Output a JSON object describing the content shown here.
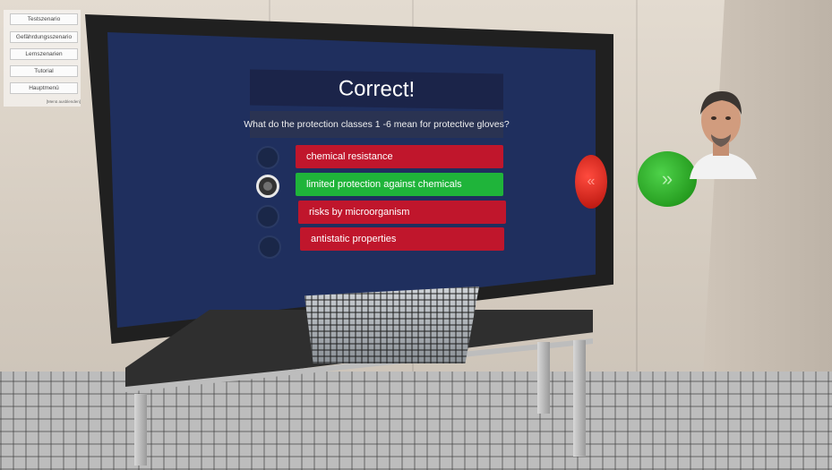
{
  "menu": {
    "items": [
      {
        "label": "Testszenario"
      },
      {
        "label": "Gefährdungsszenario"
      },
      {
        "label": "Lernszenarien"
      },
      {
        "label": "Tutorial"
      },
      {
        "label": "Hauptmenü"
      }
    ],
    "hint": "[Menü ausblenden]"
  },
  "quiz": {
    "title": "Correct!",
    "question": "What do the protection classes 1 -6 mean for protective gloves?",
    "answers": [
      {
        "label": "chemical resistance",
        "state": "wrong",
        "selected": false
      },
      {
        "label": "limited protection against chemicals",
        "state": "correct",
        "selected": true
      },
      {
        "label": "risks by microorganism",
        "state": "wrong",
        "selected": false
      },
      {
        "label": "antistatic properties",
        "state": "wrong",
        "selected": false
      }
    ]
  },
  "nav": {
    "back_glyph": "«",
    "next_glyph": "»"
  },
  "icons": {
    "back": "rewind-icon",
    "next": "forward-icon",
    "avatar": "trainer-avatar"
  },
  "colors": {
    "correct": "#1fb43a",
    "wrong": "#c0162c",
    "board": "#1f2f5e"
  }
}
